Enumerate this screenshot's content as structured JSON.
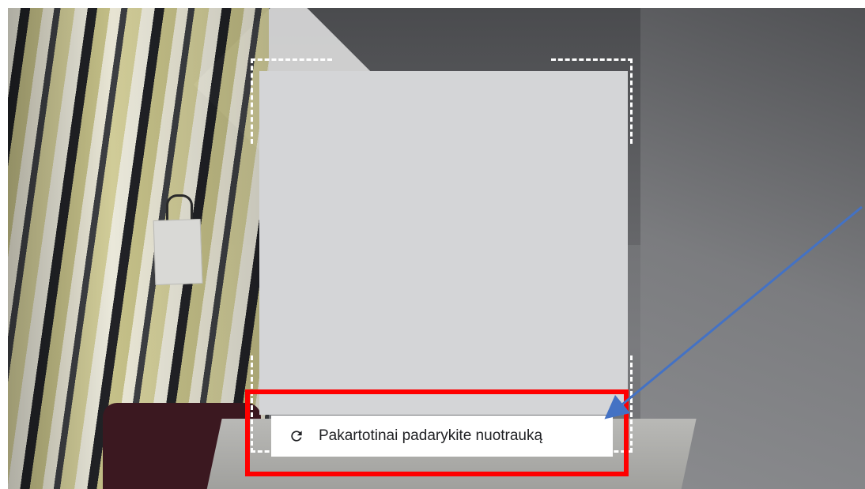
{
  "camera": {
    "retake_button": {
      "label": "Pakartotinai padarykite nuotrauką",
      "icon": "refresh-icon"
    }
  },
  "annotation": {
    "highlight_color": "#ff0000",
    "arrow_color": "#4472c4"
  }
}
